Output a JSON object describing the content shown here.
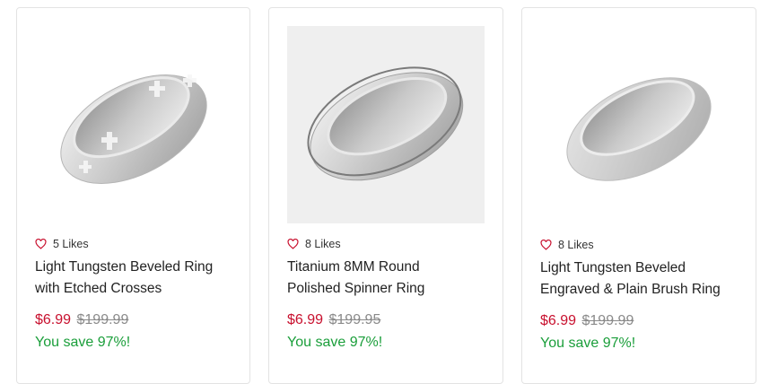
{
  "products": [
    {
      "likes": "5 Likes",
      "title_line1": "Light Tungsten Beveled Ring",
      "title_line2": "with Etched Crosses",
      "price": "$6.99",
      "original_price": "$199.99",
      "savings": "You save 97%!",
      "image_icon": "ring-etched-crosses-image"
    },
    {
      "likes": "8 Likes",
      "title_line1": "Titanium 8MM Round",
      "title_line2": "Polished Spinner Ring",
      "price": "$6.99",
      "original_price": "$199.95",
      "savings": "You save 97%!",
      "image_icon": "ring-spinner-image"
    },
    {
      "likes": "8 Likes",
      "title_line1": "Light Tungsten Beveled",
      "title_line2": "Engraved & Plain Brush Ring",
      "price": "$6.99",
      "original_price": "$199.99",
      "savings": "You save 97%!",
      "image_icon": "ring-brushed-image"
    }
  ],
  "colors": {
    "sale_price": "#c8102e",
    "original_price": "#8a8a8a",
    "savings": "#1a9e3a",
    "heart": "#c8102e"
  }
}
